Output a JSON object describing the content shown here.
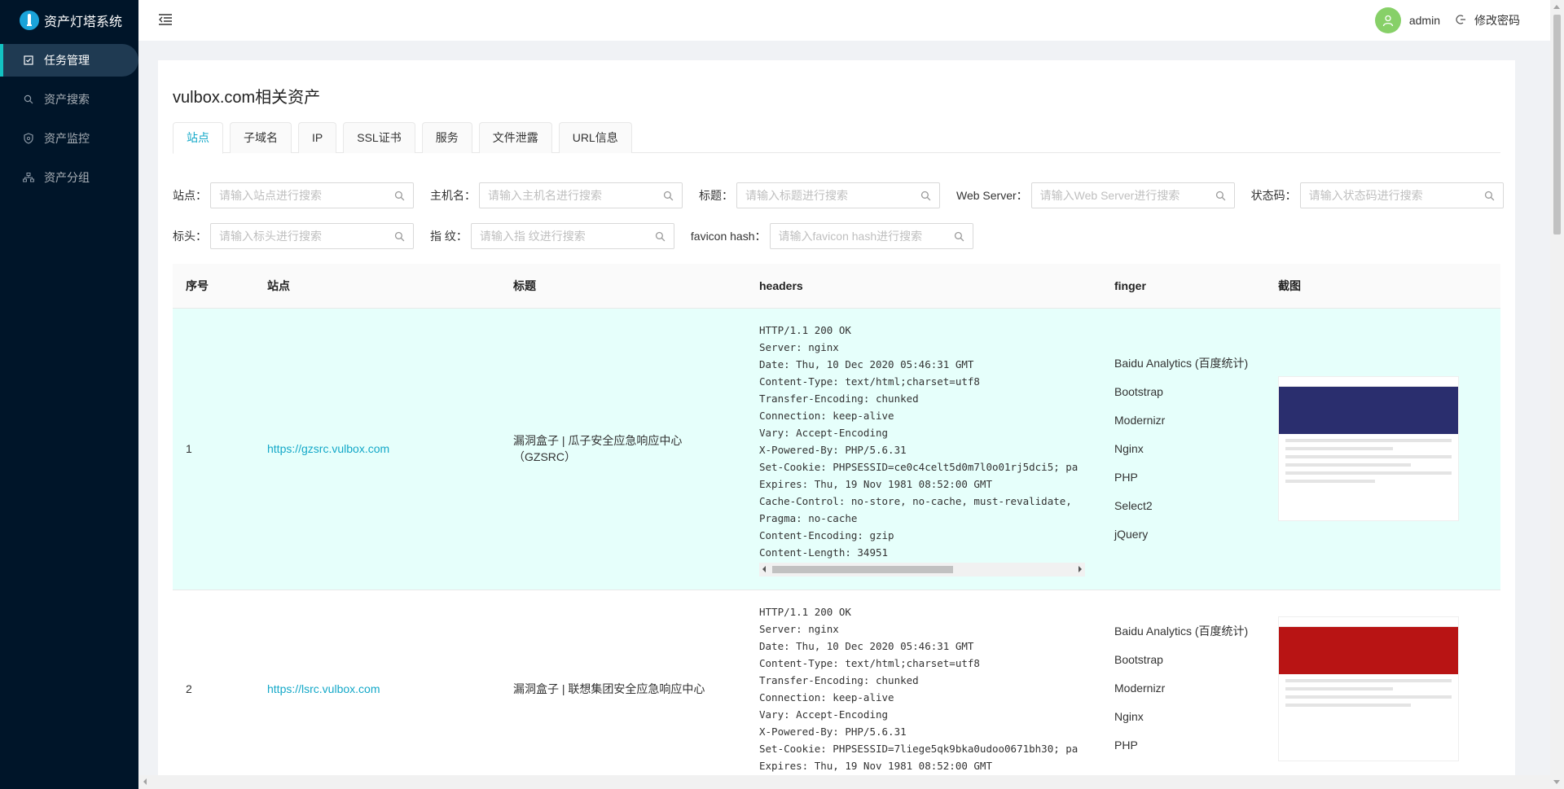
{
  "app": {
    "title": "资产灯塔系统"
  },
  "sidebar": {
    "items": [
      {
        "label": "任务管理",
        "icon": "task-icon",
        "active": true
      },
      {
        "label": "资产搜索",
        "icon": "search-icon",
        "active": false
      },
      {
        "label": "资产监控",
        "icon": "monitor-icon",
        "active": false
      },
      {
        "label": "资产分组",
        "icon": "group-icon",
        "active": false
      }
    ]
  },
  "header": {
    "username": "admin",
    "change_password": "修改密码"
  },
  "page": {
    "title": "vulbox.com相关资产",
    "tabs": [
      "站点",
      "子域名",
      "IP",
      "SSL证书",
      "服务",
      "文件泄露",
      "URL信息"
    ]
  },
  "filters": {
    "row1": [
      {
        "label": "站点：",
        "placeholder": "请输入站点进行搜索"
      },
      {
        "label": "主机名：",
        "placeholder": "请输入主机名进行搜索"
      },
      {
        "label": "标题：",
        "placeholder": "请输入标题进行搜索"
      },
      {
        "label": "Web Server：",
        "placeholder": "请输入Web Server进行搜索"
      },
      {
        "label": "状态码：",
        "placeholder": "请输入状态码进行搜索"
      }
    ],
    "row2": [
      {
        "label": "标头：",
        "placeholder": "请输入标头进行搜索"
      },
      {
        "label": "指 纹：",
        "placeholder": "请输入指 纹进行搜索"
      },
      {
        "label": "favicon hash：",
        "placeholder": "请输入favicon hash进行搜索"
      }
    ]
  },
  "table": {
    "columns": [
      "序号",
      "站点",
      "标题",
      "headers",
      "finger",
      "截图"
    ],
    "rows": [
      {
        "index": "1",
        "site": "https://gzsrc.vulbox.com",
        "title": "漏洞盒子 | 瓜子安全应急响应中心（GZSRC）",
        "headers": "HTTP/1.1 200 OK\nServer: nginx\nDate: Thu, 10 Dec 2020 05:46:31 GMT\nContent-Type: text/html;charset=utf8\nTransfer-Encoding: chunked\nConnection: keep-alive\nVary: Accept-Encoding\nX-Powered-By: PHP/5.6.31\nSet-Cookie: PHPSESSID=ce0c4celt5d0m7l0o01rj5dci5; pa\nExpires: Thu, 19 Nov 1981 08:52:00 GMT\nCache-Control: no-store, no-cache, must-revalidate,\nPragma: no-cache\nContent-Encoding: gzip\nContent-Length: 34951",
        "finger": [
          "Baidu Analytics (百度统计)",
          "Bootstrap",
          "Modernizr",
          "Nginx",
          "PHP",
          "Select2",
          "jQuery"
        ],
        "shot_color": "#2a2e6e"
      },
      {
        "index": "2",
        "site": "https://lsrc.vulbox.com",
        "title": "漏洞盒子 | 联想集团安全应急响应中心",
        "headers": "HTTP/1.1 200 OK\nServer: nginx\nDate: Thu, 10 Dec 2020 05:46:31 GMT\nContent-Type: text/html;charset=utf8\nTransfer-Encoding: chunked\nConnection: keep-alive\nVary: Accept-Encoding\nX-Powered-By: PHP/5.6.31\nSet-Cookie: PHPSESSID=7liege5qk9bka0udoo0671bh30; pa\nExpires: Thu, 19 Nov 1981 08:52:00 GMT",
        "finger": [
          "Baidu Analytics (百度统计)",
          "Bootstrap",
          "Modernizr",
          "Nginx",
          "PHP"
        ],
        "shot_color": "#b81414"
      }
    ]
  },
  "colors": {
    "sidebar_bg": "#001529",
    "accent": "#13a8c8",
    "row_highlight": "#e6fffb"
  }
}
